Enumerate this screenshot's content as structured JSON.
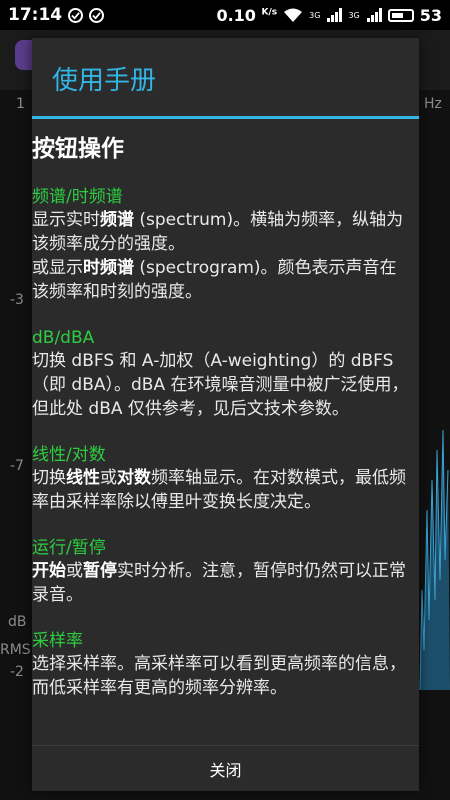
{
  "status_bar": {
    "time": "17:14",
    "speed": "0.10",
    "speed_unit": "K/s",
    "sig1_label": "3G",
    "sig2_label": "3G",
    "battery": "53"
  },
  "background": {
    "labels": [
      "1",
      "Hz",
      "-3",
      "-7",
      "dB",
      "RMS",
      "-2"
    ]
  },
  "dialog": {
    "title": "使用手册",
    "heading": "按钮操作",
    "sections": [
      {
        "title": "频谱/时频谱",
        "lines": [
          [
            "显示实时",
            "频谱",
            " (spectrum)。横轴为频率，纵轴为该频率成分的强度。"
          ],
          [
            "或显示",
            "时频谱",
            " (spectrogram)。颜色表示声音在该频率和时刻的强度。"
          ]
        ]
      },
      {
        "title": "dB/dBA",
        "text": "切换 dBFS 和 A-加权（A-weighting）的 dBFS（即 dBA）。dBA 在环境噪音测量中被广泛使用，但此处 dBA 仅供参考，见后文技术参数。"
      },
      {
        "title": "线性/对数",
        "parts": [
          "切换",
          "线性",
          "或",
          "对数",
          "频率轴显示。在对数模式，最低频率由采样率除以傅里叶变换长度决定。"
        ]
      },
      {
        "title": "运行/暂停",
        "parts": [
          "开始",
          "或",
          "暂停",
          "实时分析。注意，暂停时仍然可以正常录音。"
        ]
      },
      {
        "title": "采样率",
        "text": "选择采样率。高采样率可以看到更高频率的信息，而低采样率有更高的频率分辨率。"
      }
    ],
    "close_label": "关闭"
  }
}
